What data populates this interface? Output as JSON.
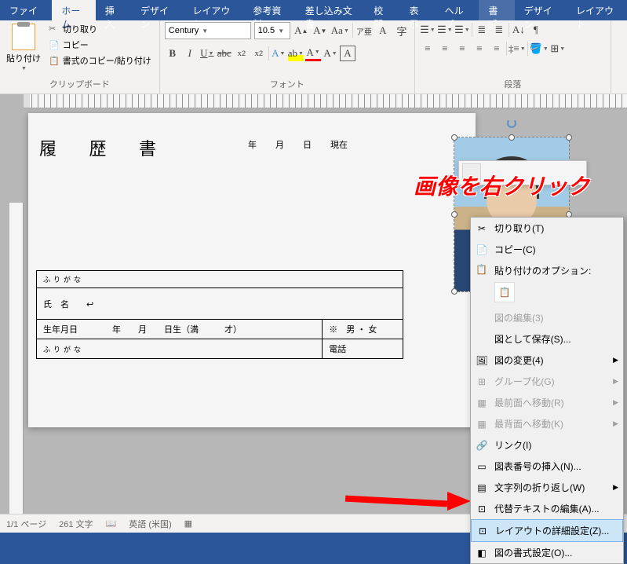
{
  "tabs": {
    "file": "ファイル",
    "home": "ホーム",
    "insert": "挿入",
    "design": "デザイン",
    "layout": "レイアウト",
    "ref": "参考資料",
    "mail": "差し込み文書",
    "review": "校閲",
    "view": "表示",
    "help": "ヘルプ",
    "format": "書式",
    "design2": "デザイン",
    "layout2": "レイアウト"
  },
  "ribbon": {
    "paste": "貼り付け",
    "cut": "切り取り",
    "copy": "コピー",
    "formatPainter": "書式のコピー/貼り付け",
    "clipboardGroup": "クリップボード",
    "fontGroup": "フォント",
    "paraGroup": "段落",
    "fontName": "Century",
    "fontSize": "10.5"
  },
  "doc": {
    "title": "履 歴 書",
    "year": "年",
    "month": "月",
    "day": "日",
    "current": "現在",
    "furigana": "ふりがな",
    "name": "氏　名",
    "dob": "生年月日",
    "born": "日生（満",
    "age": "才）",
    "gender": "※　男 ・ 女",
    "phone": "電話"
  },
  "annotation": "画像を右クリック",
  "ctx": {
    "cut": "切り取り(T)",
    "copy": "コピー(C)",
    "pasteOpts": "貼り付けのオプション:",
    "editImg": "図の編集(3)",
    "saveAs": "図として保存(S)...",
    "changeImg": "図の変更(4)",
    "group": "グループ化(G)",
    "bringFront": "最前面へ移動(R)",
    "sendBack": "最背面へ移動(K)",
    "link": "リンク(I)",
    "caption": "図表番号の挿入(N)...",
    "wrap": "文字列の折り返し(W)",
    "altText": "代替テキストの編集(A)...",
    "layoutAdv": "レイアウトの詳細設定(Z)...",
    "formatPic": "図の書式設定(O)..."
  },
  "status": {
    "page": "1/1 ページ",
    "words": "261 文字",
    "lang": "英語 (米国)"
  }
}
